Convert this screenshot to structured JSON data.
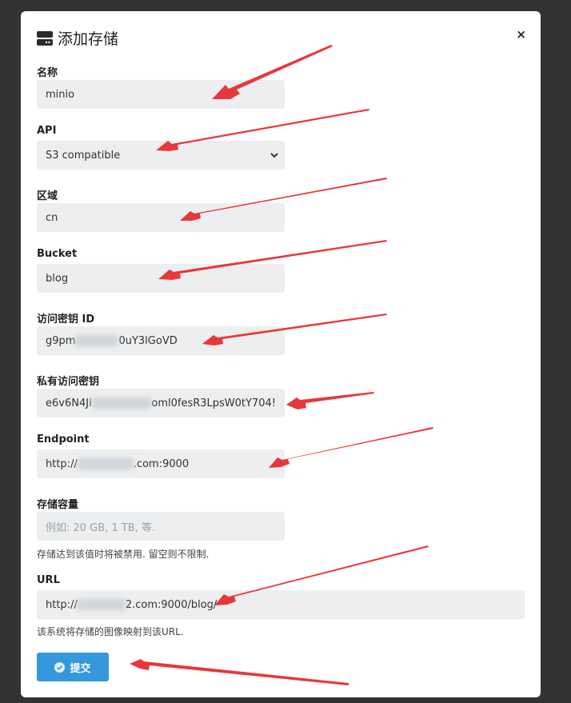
{
  "modal": {
    "title": "添加存储",
    "close_icon": "×"
  },
  "form": {
    "name": {
      "label": "名称",
      "value": "minio"
    },
    "api": {
      "label": "API",
      "value": "S3 compatible"
    },
    "region": {
      "label": "区域",
      "value": "cn"
    },
    "bucket": {
      "label": "Bucket",
      "value": "blog"
    },
    "access_key": {
      "label": "访问密钥 ID",
      "value_start": "g9pm",
      "value_end": "0uY3lGoVD"
    },
    "secret_key": {
      "label": "私有访问密钥",
      "value_start": "e6v6N4Ji",
      "value_end": "oml0fesR3LpsW0tY704!"
    },
    "endpoint": {
      "label": "Endpoint",
      "value_start": "http://",
      "value_end": ".com:9000"
    },
    "capacity": {
      "label": "存储容量",
      "placeholder": "例如: 20 GB, 1 TB, 等.",
      "help": "存储达到该值时将被禁用. 留空则不限制."
    },
    "url": {
      "label": "URL",
      "value_start": "http://",
      "value_end": "2.com:9000/blog/",
      "help": "该系统将存储的图像映射到该URL."
    },
    "submit_label": "提交"
  },
  "icons": {
    "header": "storage-icon",
    "close": "close-icon",
    "chevron": "chevron-down-icon",
    "submit": "check-circle-icon"
  },
  "colors": {
    "backdrop": "#323232",
    "modal_bg": "#ffffff",
    "field_bg": "#eceeef",
    "primary": "#3498db",
    "annotation_arrow": "#e8373a"
  }
}
